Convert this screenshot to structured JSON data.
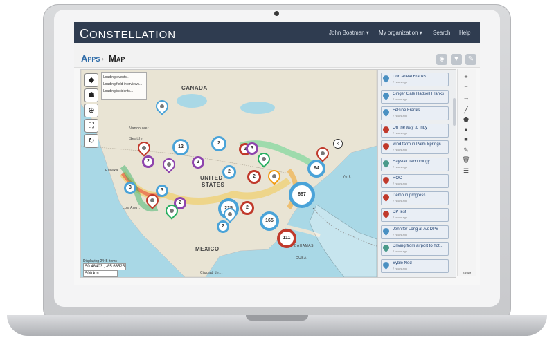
{
  "app": {
    "brand": "ONSTELLATION",
    "brand_mark": "C"
  },
  "topbar": {
    "user": "John Boatman ▾",
    "org": "My organization ▾",
    "search": "Search",
    "help": "Help"
  },
  "breadcrumb": {
    "apps": "Apps",
    "sep": "›",
    "page": "Map"
  },
  "map": {
    "labels": {
      "canada": "CANADA",
      "united": "UNITED",
      "states": "STATES",
      "mexico": "MEXICO",
      "cuba": "CUBA",
      "bahamas": "BAHAMAS",
      "vancouver": "Vancouver",
      "seattle": "Seattle",
      "eureka": "Eureka",
      "los_angeles": "Los Ang..",
      "new_york": "York",
      "cuba_city": "Ciudad de..."
    },
    "loading": [
      "Loading events...",
      "Loading field interviews...",
      "Loading incidents..."
    ],
    "displaying": "Displaying 2445 items",
    "coords": "50.48403 , -85.63525",
    "scale": "500 km",
    "clusters": [
      "2",
      "12",
      "2",
      "3",
      "2",
      "2",
      "94",
      "667",
      "225",
      "2",
      "165",
      "111",
      "2",
      "3",
      "3",
      "2",
      "2",
      "2"
    ],
    "attribution": "Leaflet"
  },
  "panel": {
    "items": [
      {
        "title": "Don Arteal Franks",
        "sub": "7 hours ago",
        "color": "#4a90c2"
      },
      {
        "title": "Ginger Gale Hadsell Franks",
        "sub": "7 hours ago",
        "color": "#4a90c2"
      },
      {
        "title": "Felsipe Franks",
        "sub": "7 hours ago",
        "color": "#4a90c2"
      },
      {
        "title": "On the way to Indy",
        "sub": "7 hours ago",
        "color": "#c0392b"
      },
      {
        "title": "wind farm in Palm Springs",
        "sub": "7 hours ago",
        "color": "#c0392b"
      },
      {
        "title": "Haystax Technology",
        "sub": "7 hours ago",
        "color": "#4a9a8a"
      },
      {
        "title": "ROC",
        "sub": "7 hours ago",
        "color": "#c0392b"
      },
      {
        "title": "Demo in progress",
        "sub": "7 hours ago",
        "color": "#c0392b"
      },
      {
        "title": "DP test",
        "sub": "7 hours ago",
        "color": "#c0392b"
      },
      {
        "title": "Jennifer Long at AZ DPS",
        "sub": "7 hours ago",
        "color": "#4a90c2"
      },
      {
        "title": "Driving from airport to hotel. - Douglas (Demo) Pasley",
        "sub": "7 hours ago",
        "color": "#4a9a8a"
      },
      {
        "title": "Syble Ned",
        "sub": "7 hours ago",
        "color": "#4a90c2"
      }
    ]
  },
  "colors": {
    "topbar": "#2f3c50",
    "accent": "#2d6ba8",
    "water": "#a9d8e6",
    "land": "#e9e4d4"
  }
}
